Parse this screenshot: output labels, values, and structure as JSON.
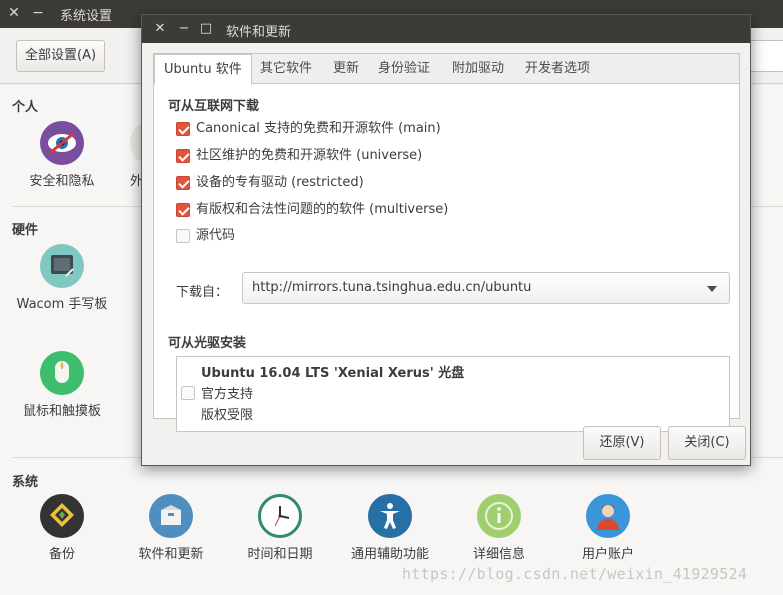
{
  "bg_window": {
    "title": "系统设置",
    "close_glyph": "✕",
    "minimize_glyph": "−",
    "all_settings_label": "全部设置(A)",
    "sections": {
      "personal": "个人",
      "hardware": "硬件",
      "system": "系统"
    },
    "personal_items": [
      {
        "label": "安全和隐私",
        "icon": "privacy-eye-icon"
      },
      {
        "label": "外",
        "icon": "appearance-icon"
      }
    ],
    "hardware_items": [
      {
        "label": "Wacom 手写板",
        "icon": "wacom-tablet-icon"
      },
      {
        "label": "鼠标和触摸板",
        "icon": "mouse-icon"
      }
    ],
    "system_items": [
      {
        "label": "备份",
        "icon": "backup-icon"
      },
      {
        "label": "软件和更新",
        "icon": "software-updates-icon"
      },
      {
        "label": "时间和日期",
        "icon": "clock-icon"
      },
      {
        "label": "通用辅助功能",
        "icon": "accessibility-icon"
      },
      {
        "label": "详细信息",
        "icon": "info-icon"
      },
      {
        "label": "用户账户",
        "icon": "user-accounts-icon"
      }
    ]
  },
  "dialog": {
    "title": "软件和更新",
    "close_glyph": "✕",
    "minimize_glyph": "−",
    "maximize_glyph": "□",
    "tabs": [
      "Ubuntu 软件",
      "其它软件",
      "更新",
      "身份验证",
      "附加驱动",
      "开发者选项"
    ],
    "active_tab": "Ubuntu 软件",
    "internet_header": "可从互联网下载",
    "sources": [
      {
        "label": "Canonical 支持的免费和开源软件 (main)",
        "checked": true
      },
      {
        "label": "社区维护的免费和开源软件 (universe)",
        "checked": true
      },
      {
        "label": "设备的专有驱动 (restricted)",
        "checked": true
      },
      {
        "label": "有版权和合法性问题的的软件 (multiverse)",
        "checked": true
      },
      {
        "label": "源代码",
        "checked": false
      }
    ],
    "download_from_label": "下载自：",
    "download_from_value": "http://mirrors.tuna.tsinghua.edu.cn/ubuntu",
    "cdrom_header": "可从光驱安装",
    "cdrom": {
      "name": "Ubuntu 16.04 LTS 'Xenial Xerus' 光盘",
      "line2": "官方支持",
      "line3": "版权受限",
      "checked": false
    },
    "revert_button": "还原(V)",
    "close_button": "关闭(C)"
  },
  "watermark": "https://blog.csdn.net/weixin_41929524",
  "colors": {
    "titlebar": "#3c3b37",
    "checkbox_accent": "#e0543c"
  }
}
